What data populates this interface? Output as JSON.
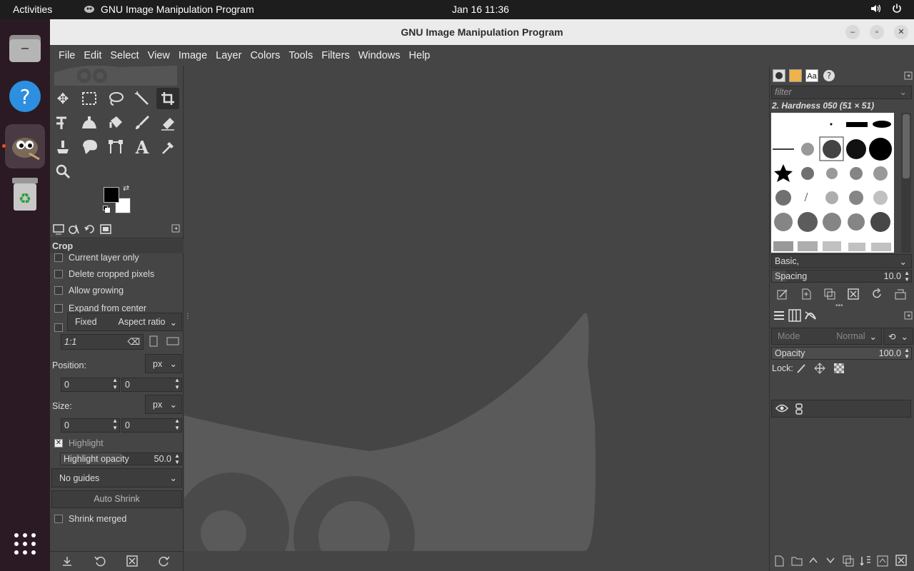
{
  "topbar": {
    "activities": "Activities",
    "app_name": "GNU Image Manipulation Program",
    "clock": "Jan 16  11:36"
  },
  "window": {
    "title": "GNU Image Manipulation Program"
  },
  "menu": [
    "File",
    "Edit",
    "Select",
    "View",
    "Image",
    "Layer",
    "Colors",
    "Tools",
    "Filters",
    "Windows",
    "Help"
  ],
  "tool_options": {
    "title": "Crop",
    "current_layer_only": "Current layer only",
    "delete_cropped_pixels": "Delete cropped pixels",
    "allow_growing": "Allow growing",
    "expand_from_center": "Expand from center",
    "fixed": "Fixed",
    "aspect_ratio": "Aspect ratio",
    "ratio_value": "1:1",
    "position_label": "Position:",
    "position_unit": "px",
    "position_x": "0",
    "position_y": "0",
    "size_label": "Size:",
    "size_unit": "px",
    "size_w": "0",
    "size_h": "0",
    "highlight": "Highlight",
    "highlight_opacity_label": "Highlight opacity",
    "highlight_opacity_value": "50.0",
    "guides": "No guides",
    "auto_shrink": "Auto Shrink",
    "shrink_merged": "Shrink merged"
  },
  "brushes": {
    "filter_placeholder": "filter",
    "selected_brush": "2. Hardness 050 (51 × 51)",
    "tag": "Basic,",
    "spacing_label": "Spacing",
    "spacing_value": "10.0"
  },
  "layers": {
    "mode_label": "Mode",
    "mode_value": "Normal",
    "opacity_label": "Opacity",
    "opacity_value": "100.0",
    "lock_label": "Lock:"
  },
  "colors": {
    "foreground": "#000000",
    "background": "#ffffff"
  }
}
